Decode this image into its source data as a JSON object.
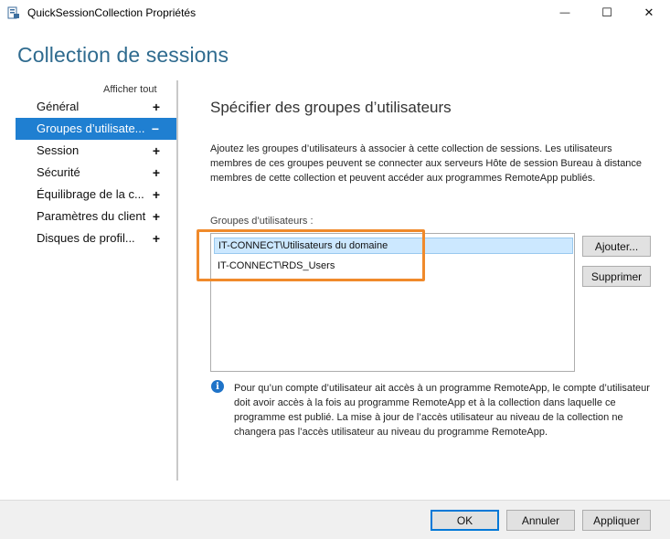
{
  "window": {
    "title": "QuickSessionCollection Propriétés",
    "minimize_glyph": "—",
    "maximize_glyph": "☐",
    "close_glyph": "✕",
    "icon": "server-properties-icon"
  },
  "heading": "Collection de sessions",
  "sidebar": {
    "show_all": "Afficher tout",
    "items": [
      {
        "label": "Général",
        "toggle": "+",
        "active": false
      },
      {
        "label": "Groupes d’utilisate...",
        "toggle": "−",
        "active": true
      },
      {
        "label": "Session",
        "toggle": "+",
        "active": false
      },
      {
        "label": "Sécurité",
        "toggle": "+",
        "active": false
      },
      {
        "label": "Équilibrage de la c...",
        "toggle": "+",
        "active": false
      },
      {
        "label": "Paramètres du client",
        "toggle": "+",
        "active": false
      },
      {
        "label": "Disques de profil...",
        "toggle": "+",
        "active": false
      }
    ]
  },
  "main": {
    "title": "Spécifier des groupes d’utilisateurs",
    "description": "Ajoutez les groupes d’utilisateurs à associer à cette collection de sessions. Les utilisateurs membres de ces groupes peuvent se connecter aux serveurs Hôte de session Bureau à distance membres de cette collection et peuvent accéder aux programmes RemoteApp publiés.",
    "groups_label": "Groupes d’utilisateurs :",
    "groups": [
      "IT-CONNECT\\Utilisateurs du domaine",
      "IT-CONNECT\\RDS_Users"
    ],
    "add_button": "Ajouter...",
    "remove_button": "Supprimer",
    "info_glyph": "i",
    "info_text": "Pour qu’un compte d’utilisateur ait accès à un programme RemoteApp, le compte d’utilisateur doit avoir accès à la fois au programme RemoteApp et à la collection dans laquelle ce programme est publié. La mise à jour de l’accès utilisateur au niveau de la collection ne changera pas l’accès utilisateur au niveau du programme RemoteApp."
  },
  "footer": {
    "ok": "OK",
    "cancel": "Annuler",
    "apply": "Appliquer"
  },
  "colors": {
    "accent": "#1f7fd1",
    "heading": "#2f6b8f",
    "highlight": "#f08a2b",
    "selection": "#cce8ff"
  }
}
